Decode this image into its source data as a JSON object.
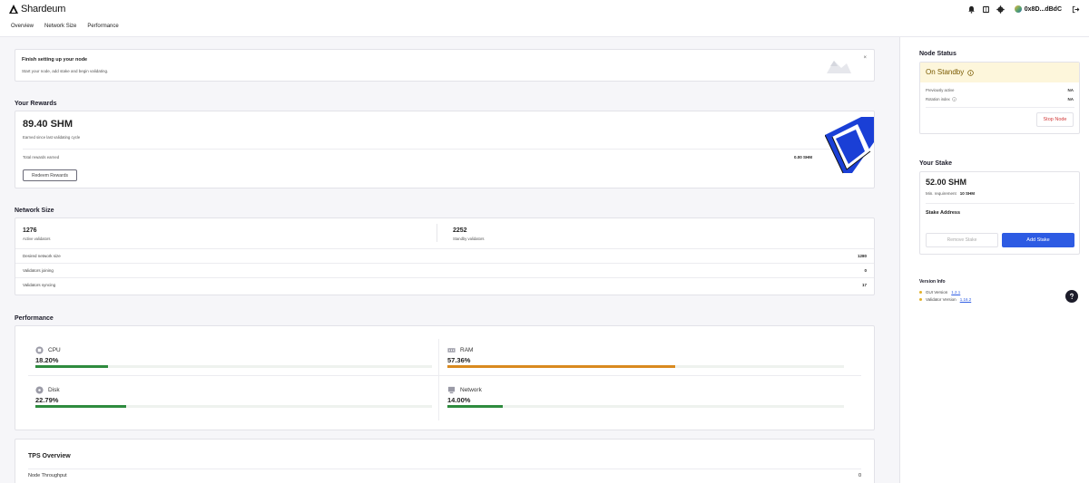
{
  "app": {
    "logo_text": "Shardeum"
  },
  "header": {
    "wallet_label": "0x8D...dBdC"
  },
  "nav": {
    "tabs": [
      "Overview",
      "Network Size",
      "Performance"
    ]
  },
  "banner": {
    "title": "Finish setting up your node",
    "subtitle": "Start your node, add stake and begin validating.",
    "close": "×"
  },
  "rewards": {
    "section_title": "Your Rewards",
    "amount": "89.40 SHM",
    "subtitle": "Earned since last validating cycle",
    "total_label": "Total rewards earned",
    "total_value": "0.00 SHM",
    "redeem_label": "Redeem Rewards"
  },
  "network": {
    "section_title": "Network Size",
    "active_count": "1276",
    "active_label": "Active validators",
    "standby_count": "2252",
    "standby_label": "Standby validators",
    "rows": [
      {
        "label": "Desired network size",
        "value": "1280"
      },
      {
        "label": "Validators joining",
        "value": "0"
      },
      {
        "label": "Validators syncing",
        "value": "17"
      }
    ]
  },
  "performance": {
    "section_title": "Performance",
    "metrics": [
      {
        "name": "CPU",
        "value": "18.20%",
        "percent": 18.2,
        "icon": "cpu-icon"
      },
      {
        "name": "RAM",
        "value": "57.36%",
        "percent": 57.36,
        "icon": "ram-icon"
      },
      {
        "name": "Disk",
        "value": "22.79%",
        "percent": 22.79,
        "icon": "disk-icon"
      },
      {
        "name": "Network",
        "value": "14.00%",
        "percent": 14.0,
        "icon": "network-icon"
      }
    ],
    "colors": {
      "cpu": "#2e8b3e",
      "ram": "#d98a1f",
      "disk": "#2e8b3e",
      "network": "#2e8b3e"
    }
  },
  "tps": {
    "title": "TPS Overview",
    "row_label": "Node Throughput",
    "row_value": "0"
  },
  "side": {
    "node_status_title": "Node Status",
    "status": "On Standby",
    "previously_active_label": "Previously active",
    "previously_active_value": "NA",
    "rotation_index_label": "Rotation index",
    "rotation_index_value": "NA",
    "stop_label": "Stop Node",
    "stake_title": "Your Stake",
    "stake_amount": "52.00 SHM",
    "min_req_label": "Min. requirement",
    "min_req_value": "10 SHM",
    "stake_address_label": "Stake Address",
    "remove_label": "Remove Stake",
    "add_label": "Add Stake",
    "version_title": "Version Info",
    "gui_version_label": "GUI Version",
    "gui_version": "1.2.1",
    "validator_version_label": "Validator Version",
    "validator_version": "1.16.2"
  }
}
